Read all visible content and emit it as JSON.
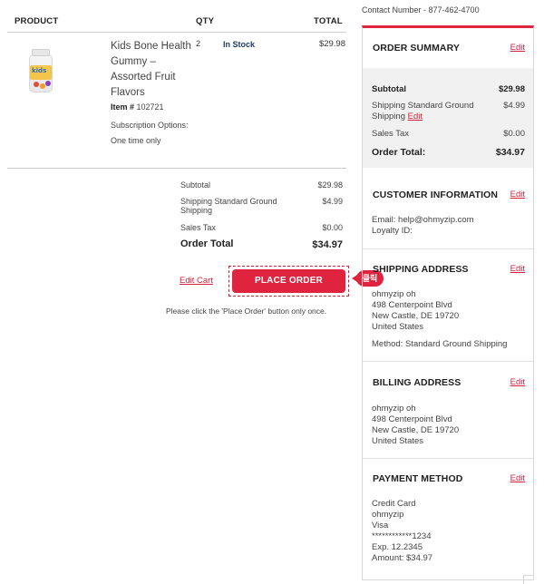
{
  "table": {
    "col_product": "PRODUCT",
    "col_qty": "QTY",
    "col_total": "TOTAL"
  },
  "product": {
    "image_icon": "vitamin-gummy-jar",
    "image_text": "kids",
    "name": "Kids Bone Health Gummy – Assorted Fruit Flavors",
    "item_label": "Item #",
    "item_number": "102721",
    "subscription": "Subscription Options: One time only",
    "qty": "2",
    "stock": "In Stock",
    "price": "$29.98"
  },
  "left_totals": {
    "subtotal_label": "Subtotal",
    "subtotal_value": "$29.98",
    "shipping_label": "Shipping Standard Ground Shipping",
    "shipping_value": "$4.99",
    "tax_label": "Sales Tax",
    "tax_value": "$0.00",
    "total_label": "Order Total",
    "total_value": "$34.97"
  },
  "actions": {
    "edit_cart": "Edit Cart",
    "place_order": "PLACE ORDER",
    "click_badge": "클릭",
    "note": "Please click the 'Place Order' button only once."
  },
  "contact": "Contact Number - 877-462-4700",
  "summary": {
    "title": "ORDER SUMMARY",
    "edit": "Edit",
    "subtotal_label": "Subtotal",
    "subtotal_value": "$29.98",
    "shipping_label": "Shipping Standard Ground Shipping",
    "shipping_edit": "Edit",
    "shipping_value": "$4.99",
    "tax_label": "Sales Tax",
    "tax_value": "$0.00",
    "total_label": "Order Total:",
    "total_value": "$34.97"
  },
  "customer": {
    "title": "CUSTOMER INFORMATION",
    "edit": "Edit",
    "email": "Email: help@ohmyzip.com",
    "loyalty": "Loyalty ID:"
  },
  "shipping": {
    "title": "SHIPPING ADDRESS",
    "edit": "Edit",
    "name": "ohmyzip oh",
    "street": "498 Centerpoint Blvd",
    "city": "New Castle, DE 19720",
    "country": "United States",
    "method": "Method: Standard Ground Shipping"
  },
  "billing": {
    "title": "BILLING ADDRESS",
    "edit": "Edit",
    "name": "ohmyzip oh",
    "street": "498 Centerpoint Blvd",
    "city": "New Castle, DE 19720",
    "country": "United States"
  },
  "payment": {
    "title": "PAYMENT METHOD",
    "edit": "Edit",
    "type": "Credit Card",
    "holder": "ohmyzip",
    "brand": "Visa",
    "card": "************1234",
    "exp": "Exp. 12.2345",
    "amount": "Amount: $34.97"
  },
  "colors": {
    "accent": "#e0243f",
    "link": "#d61f3c",
    "stock": "#1e3b6a",
    "summary_bg": "#f1f1f1"
  }
}
